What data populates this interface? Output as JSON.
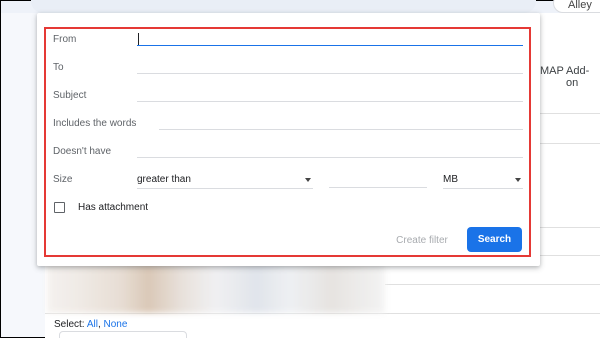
{
  "header": {
    "account_button_label": "Alley"
  },
  "background": {
    "tabs": [
      {
        "label": "MAP"
      },
      {
        "label": "Add-on"
      }
    ],
    "select": {
      "prefix": "Select:",
      "all": "All",
      "none": "None"
    }
  },
  "search_options": {
    "from": {
      "label": "From",
      "value": ""
    },
    "to": {
      "label": "To",
      "value": ""
    },
    "subject": {
      "label": "Subject",
      "value": ""
    },
    "includes": {
      "label": "Includes the words",
      "value": ""
    },
    "doesnt_have": {
      "label": "Doesn't have",
      "value": ""
    },
    "size": {
      "label": "Size",
      "comparator": "greater than",
      "value": "",
      "unit": "MB"
    },
    "has_attachment": {
      "label": "Has attachment",
      "checked": false
    },
    "create_filter_label": "Create filter",
    "search_label": "Search"
  },
  "colors": {
    "accent": "#1a73e8",
    "highlight_border": "#e53935",
    "disabled_text": "#a8abaf"
  }
}
